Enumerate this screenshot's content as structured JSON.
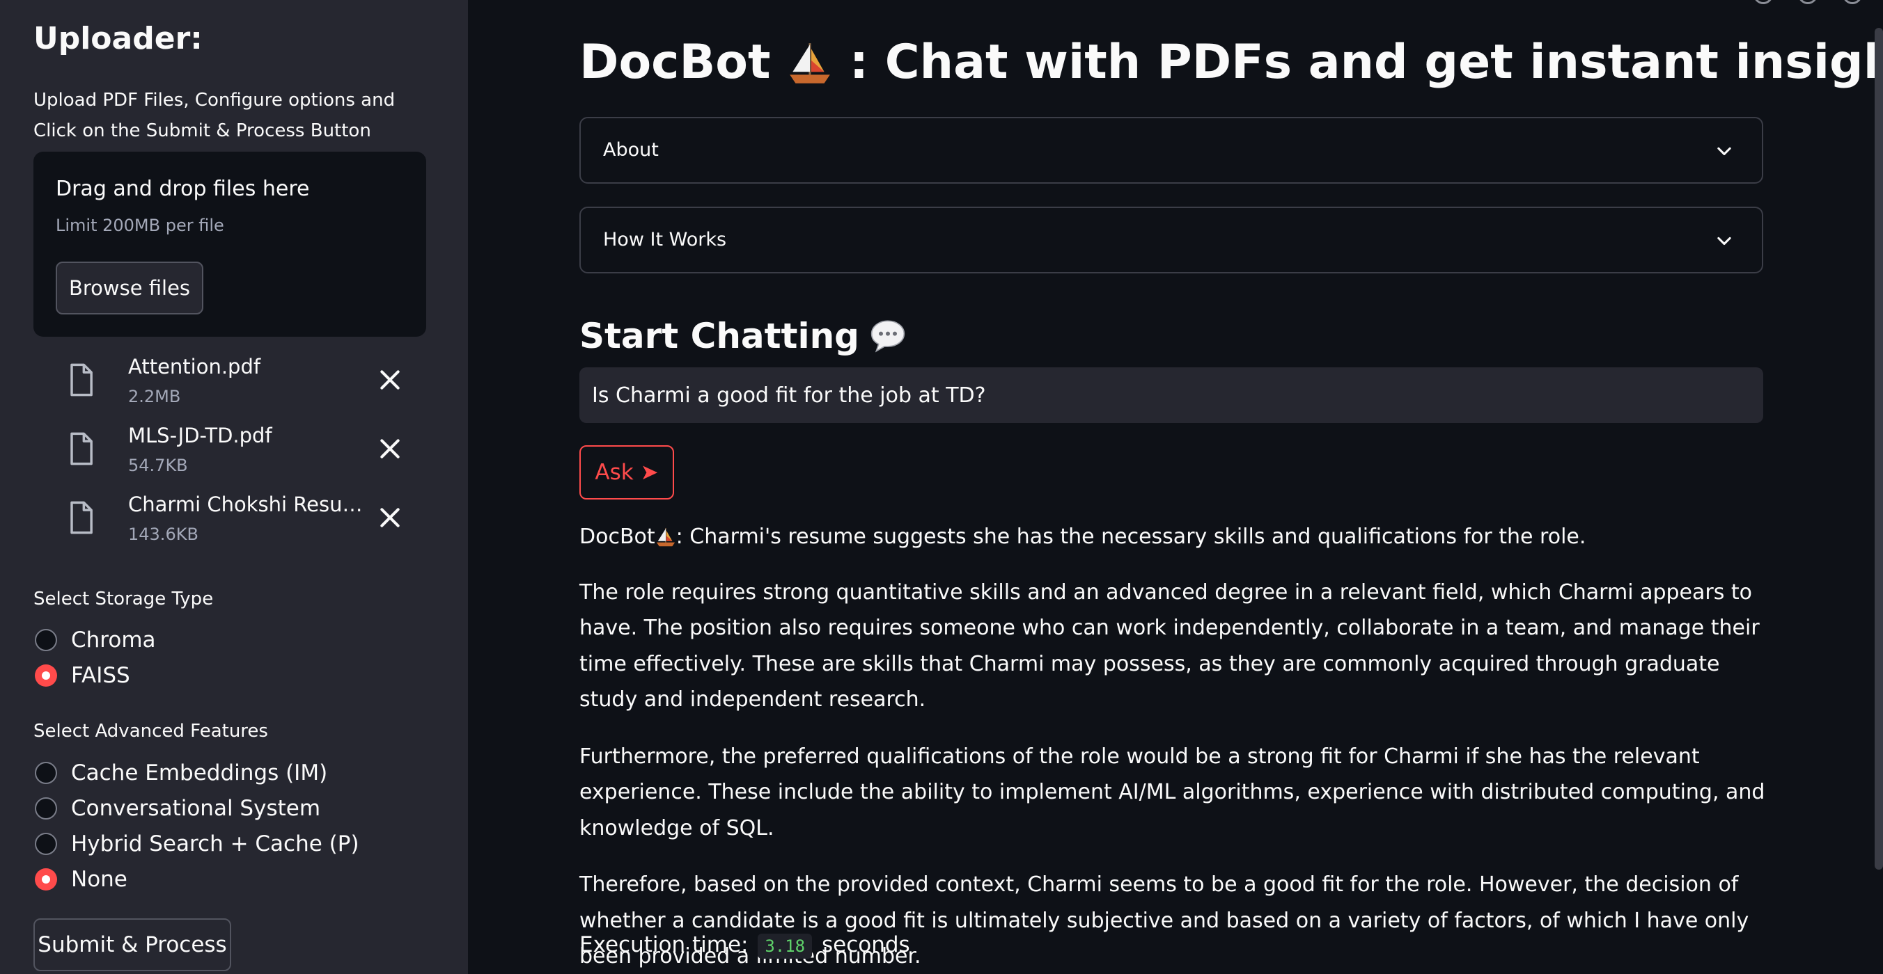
{
  "sidebar": {
    "title": "Uploader:",
    "description": "Upload PDF Files, Configure options and Click on the Submit & Process Button",
    "dropzone": {
      "title": "Drag and drop files here",
      "limit": "Limit 200MB per file",
      "browse_label": "Browse files"
    },
    "files": [
      {
        "name": "Attention.pdf",
        "size": "2.2MB"
      },
      {
        "name": "MLS-JD-TD.pdf",
        "size": "54.7KB"
      },
      {
        "name": "Charmi Chokshi Resume.pdf",
        "size": "143.6KB"
      }
    ],
    "storage": {
      "label": "Select Storage Type",
      "options": [
        "Chroma",
        "FAISS"
      ],
      "selected": "FAISS"
    },
    "features": {
      "label": "Select Advanced Features",
      "options": [
        "Cache Embeddings (IM)",
        "Conversational System",
        "Hybrid Search + Cache (P)",
        "None"
      ],
      "selected": "None"
    },
    "submit_label": "Submit & Process"
  },
  "main": {
    "title_prefix": "DocBot",
    "title_suffix": ": Chat with PDFs and get instant insights!",
    "expanders": [
      {
        "label": "About"
      },
      {
        "label": "How It Works"
      }
    ],
    "chat_header": "Start Chatting",
    "query_value": "Is Charmi a good fit for the job at TD?",
    "ask_label": "Ask ➤",
    "answer": {
      "bot_name": "DocBot",
      "first_line": ": Charmi's resume suggests she has the necessary skills and qualifications for the role.",
      "paragraphs": [
        "The role requires strong quantitative skills and an advanced degree in a relevant field, which Charmi appears to have. The position also requires someone who can work independently, collaborate in a team, and manage their time effectively. These are skills that Charmi may possess, as they are commonly acquired through graduate study and independent research.",
        "Furthermore, the preferred qualifications of the role would be a strong fit for Charmi if she has the relevant experience. These include the ability to implement AI/ML algorithms, experience with distributed computing, and knowledge of SQL.",
        "Therefore, based on the provided context, Charmi seems to be a good fit for the role. However, the decision of whether a candidate is a good fit is ultimately subjective and based on a variety of factors, of which I have only been provided a limited number."
      ]
    },
    "execution": {
      "label": "Execution time:",
      "value": "3.18",
      "unit": "seconds"
    }
  },
  "colors": {
    "accent": "#ff4b4b",
    "background": "#0e1117",
    "sidebar": "#262730",
    "code_text": "#5fd26a"
  },
  "icons": [
    "file-icon",
    "close-icon",
    "chevron-down-icon",
    "sailboat-icon",
    "speech-bubble-icon"
  ]
}
